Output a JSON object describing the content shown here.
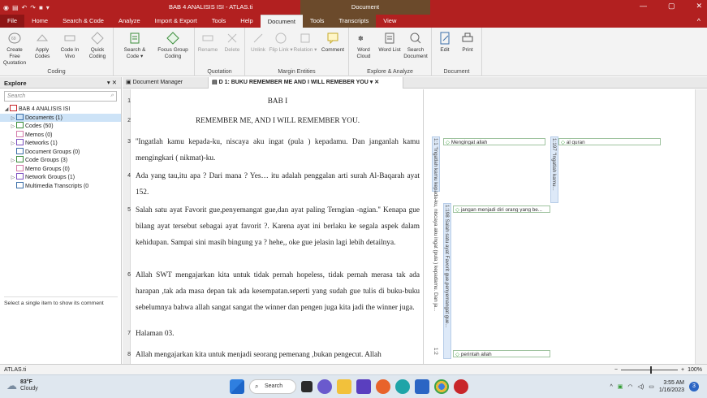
{
  "window": {
    "title": "BAB 4 ANALISIS ISI - ATLAS.ti",
    "context_group": "Document",
    "controls": {
      "minimize": "—",
      "maximize": "▢",
      "close": "✕"
    }
  },
  "menu": {
    "items": [
      "File",
      "Home",
      "Search & Code",
      "Analyze",
      "Import & Export",
      "Tools",
      "Help",
      "Document",
      "Tools",
      "Transcripts",
      "View"
    ],
    "active": "Document",
    "collapse": "^"
  },
  "ribbon": {
    "groups": [
      {
        "label": "Coding",
        "buttons": [
          "Create Free Quotation",
          "Apply Codes",
          "Code In Vivo",
          "Quick Coding"
        ]
      },
      {
        "label": "",
        "buttons": [
          "Search & Code ▾",
          "Focus Group Coding"
        ]
      },
      {
        "label": "Quotation",
        "buttons": [
          "Rename",
          "Delete"
        ]
      },
      {
        "label": "Margin Entities",
        "buttons": [
          "Unlink",
          "Flip Link ▾",
          "Relation ▾",
          "Comment"
        ]
      },
      {
        "label": "Explore & Analyze",
        "buttons": [
          "Word Cloud",
          "Word List",
          "Search Document"
        ]
      },
      {
        "label": "Document",
        "buttons": [
          "Edit",
          "Print"
        ]
      }
    ]
  },
  "explore": {
    "title": "Explore",
    "search_placeholder": "Search",
    "tree": [
      {
        "label": "BAB 4 ANALISIS ISI",
        "level": 0,
        "toggle": "◢"
      },
      {
        "label": "Documents (1)",
        "level": 1,
        "toggle": "▷",
        "selected": true
      },
      {
        "label": "Codes (50)",
        "level": 1,
        "toggle": "▷"
      },
      {
        "label": "Memos (0)",
        "level": 1,
        "toggle": ""
      },
      {
        "label": "Networks (1)",
        "level": 1,
        "toggle": "▷"
      },
      {
        "label": "Document Groups (0)",
        "level": 1,
        "toggle": ""
      },
      {
        "label": "Code Groups (3)",
        "level": 1,
        "toggle": "▷"
      },
      {
        "label": "Memo Groups (0)",
        "level": 1,
        "toggle": ""
      },
      {
        "label": "Network Groups (1)",
        "level": 1,
        "toggle": "▷"
      },
      {
        "label": "Multimedia Transcripts (0",
        "level": 1,
        "toggle": ""
      }
    ],
    "hint": "Select a single item to show its comment"
  },
  "tabs": [
    {
      "label": "Document Manager"
    },
    {
      "label": "D 1: BUKU REMEMBER ME AND I WILL REMEBER YOU",
      "active": true
    }
  ],
  "document": {
    "paragraphs": [
      {
        "num": "1",
        "text": "BAB I",
        "center": true
      },
      {
        "num": "2",
        "text": "REMEMBER ME, AND I WILL REMEMBER YOU.",
        "center": true
      },
      {
        "num": "3",
        "text": "''Ingatlah kamu kepada-ku, niscaya aku ingat (pula ) kepadamu. Dan janganlah kamu mengingkari ( nikmat)-ku."
      },
      {
        "num": "4",
        "text": "Ada yang tau,itu apa ? Dari mana ? Yes… itu adalah penggalan arti surah Al-Baqarah ayat 152."
      },
      {
        "num": "5",
        "text": "Salah satu ayat Favorit gue,penyemangat gue,dan ayat paling Terngian -ngian.'' Kenapa gue bilang ayat tersebut sebagai ayat favorit ?. Karena ayat ini berlaku ke segala aspek dalam kehidupan. Sampai sini masih bingung ya ? hehe,, oke gue jelasin lagi lebih detailnya."
      },
      {
        "num": "6",
        "text": "Allah SWT mengajarkan kita untuk tidak pernah hopeless, tidak pernah merasa tak ada harapan ,tak ada masa depan tak ada kesempatan.seperti yang sudah gue tulis di buku-buku sebelumnya bahwa allah sangat sangat the winner dan pengen juga kita jadi the winner juga."
      },
      {
        "num": "7",
        "text": "Halaman 03."
      },
      {
        "num": "8",
        "text": "Allah mengajarkan kita untuk menjadi seorang pemenang ,bukan pengecut. Allah"
      }
    ]
  },
  "margin": {
    "quotations": [
      {
        "id": "1:1",
        "text": "1:1 ''Ingatlah kamu kepada-ku, niscaya aku ingat (pula ) kepadamu. Dan ja..."
      },
      {
        "id": "1:197",
        "text": "1:197 ''Ingatlah kamu..."
      },
      {
        "id": "1:198",
        "text": "1:198 Salah satu ayat Favorit gue,penyemangat gue..."
      },
      {
        "id": "1:2",
        "text": "1:2"
      }
    ],
    "codes": [
      "Mengingat allah",
      "al quran",
      "jangan menjadi diri orang yang be...",
      "perintah allah"
    ]
  },
  "status": {
    "app": "ATLAS.ti",
    "zoom": "100%",
    "zoom_minus": "−",
    "zoom_plus": "+"
  },
  "taskbar": {
    "temp": "83°F",
    "weather": "Cloudy",
    "search": "Search",
    "time": "3:55 AM",
    "date": "1/16/2023",
    "notifications": "3",
    "tray_up": "^"
  },
  "colors": {
    "title_red": "#b22020",
    "context_brown": "#6b4a2b",
    "selected": "#cde3f7",
    "code_green": "#2e9a2e",
    "quote_blue": "#dde9f8"
  }
}
